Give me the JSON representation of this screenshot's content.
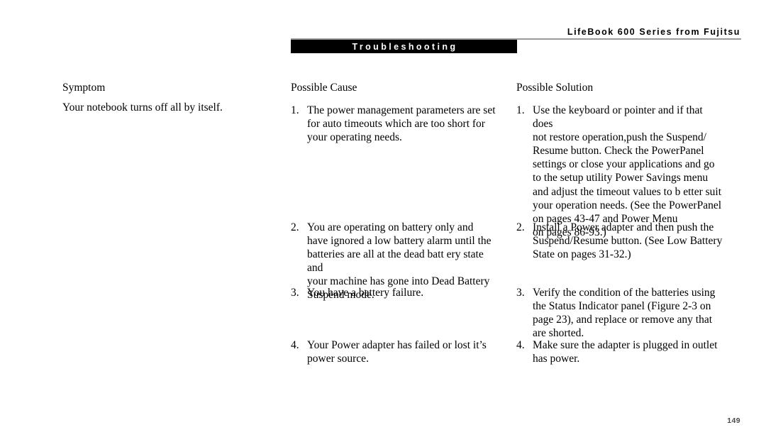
{
  "header": {
    "running_head": "LifeBook 600 Series from Fujitsu",
    "chapter_banner": "Troubleshooting"
  },
  "columns": {
    "symptom_heading": "Symptom",
    "cause_heading": "Possible Cause",
    "solution_heading": "Possible Solution"
  },
  "symptom": {
    "text": "Your notebook turns off all by itself."
  },
  "causes": [
    {
      "number": "1.",
      "text": "The power management parameters are set\nfor auto timeouts which are too short for\nyour operating needs."
    },
    {
      "number": "2.",
      "text": "You are operating on battery only and\nhave ignored a low battery alarm until the\nbatteries are all at the dead batt ery state and\nyour machine has gone into Dead Battery\nSuspend mode."
    },
    {
      "number": "3.",
      "text": "You have a battery failure."
    },
    {
      "number": "4.",
      "text": "Your Power adapter has failed or lost it’s\npower source."
    }
  ],
  "solutions": [
    {
      "number": "1.",
      "text": "Use the keyboard or pointer and if that does\nnot restore operation,push  the  Suspend/\nResume button. Check the PowerPanel\nsettings or close your applications and go\nto the setup utility Power Savings menu\nand adjust the timeout values to b etter suit\nyour operation needs. (See the PowerPanel\non pages 43-47 and Power Menu\non pages 86-93.)"
    },
    {
      "number": "2.",
      "text": "Install a Power adapter and then push the\nSuspend/Resume button. (See Low Battery\nState on pages 31-32.)"
    },
    {
      "number": "3.",
      "text": "Verify the condition of the batteries using\nthe Status Indicator panel (Figure 2-3 on\npage 23), and replace or remove any that\nare shorted."
    },
    {
      "number": "4.",
      "text": "Make sure the adapter is plugged in outlet\nhas power."
    }
  ],
  "footer": {
    "page_number": "149"
  }
}
